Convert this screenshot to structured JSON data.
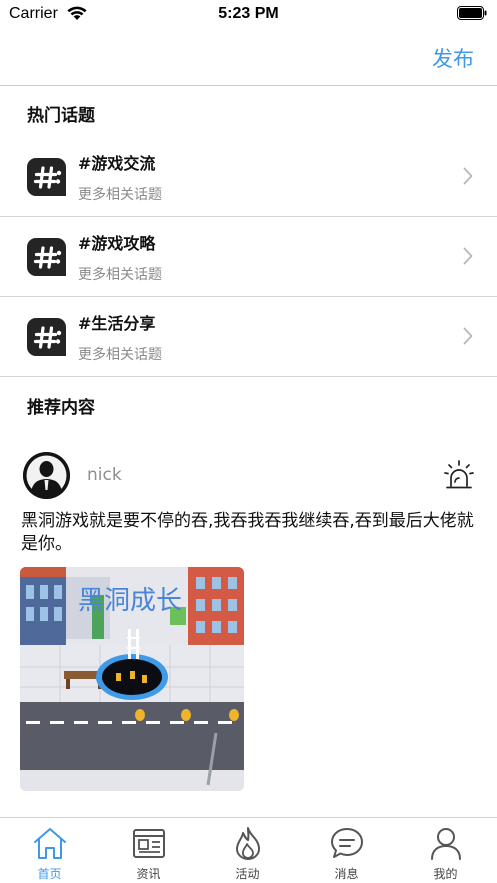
{
  "status_bar": {
    "carrier": "Carrier",
    "time": "5:23 PM"
  },
  "nav": {
    "publish_label": "发布"
  },
  "hot_topics": {
    "title": "热门话题",
    "items": [
      {
        "title": "#游戏交流",
        "subtitle": "更多相关话题"
      },
      {
        "title": "#游戏攻略",
        "subtitle": "更多相关话题"
      },
      {
        "title": "#生活分享",
        "subtitle": "更多相关话题"
      }
    ]
  },
  "recommended": {
    "title": "推荐内容",
    "post": {
      "username": "nick",
      "text": "黑洞游戏就是要不停的吞,我吞我吞我继续吞,吞到最后大佬就是你。",
      "image_caption": "黑洞成长"
    }
  },
  "tab_bar": {
    "tabs": [
      {
        "label": "首页",
        "icon": "home-icon",
        "active": true
      },
      {
        "label": "资讯",
        "icon": "news-icon",
        "active": false
      },
      {
        "label": "活动",
        "icon": "flame-icon",
        "active": false
      },
      {
        "label": "消息",
        "icon": "chat-icon",
        "active": false
      },
      {
        "label": "我的",
        "icon": "profile-icon",
        "active": false
      }
    ],
    "active_color": "#3f98e8"
  }
}
